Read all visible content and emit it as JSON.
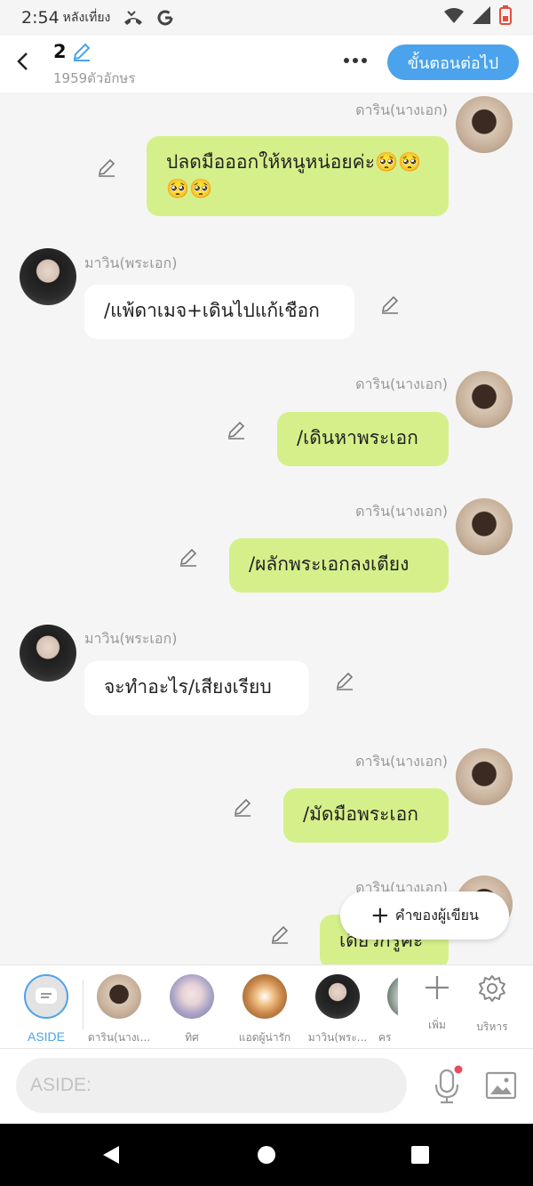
{
  "status": {
    "time": "2:54",
    "ampm": "หลังเที่ยง"
  },
  "header": {
    "chapter_number": "2",
    "char_count": "1959ตัวอักษร",
    "next_button": "ขั้นตอนต่อไป"
  },
  "messages": [
    {
      "side": "right",
      "name": "ดาริน(นางเอก)",
      "text": "ปลดมือออกให้หนูหน่อยค่ะ🥺🥺🥺🥺"
    },
    {
      "side": "left",
      "name": "มาวิน(พระเอก)",
      "text": "/แพ้ดาเมจ+เดินไปแก้เชือก"
    },
    {
      "side": "right",
      "name": "ดาริน(นางเอก)",
      "text": "/เดินหาพระเอก"
    },
    {
      "side": "right",
      "name": "ดาริน(นางเอก)",
      "text": "/ผลักพระเอกลงเตียง"
    },
    {
      "side": "left",
      "name": "มาวิน(พระเอก)",
      "text": "จะทำอะไร/เสียงเรียบ"
    },
    {
      "side": "right",
      "name": "ดาริน(นางเอก)",
      "text": "/มัดมือพระเอก"
    },
    {
      "side": "right",
      "name": "ดาริน(นางเอก)",
      "text": "เดียวกรูคะ"
    }
  ],
  "writer_button": "คำของผู้เขียน",
  "characters": [
    {
      "label": "ASIDE"
    },
    {
      "label": "ดาริน(นางเ..."
    },
    {
      "label": "ทิศ"
    },
    {
      "label": "แอดผู้น่ารัก"
    },
    {
      "label": "มาวิน(พระ..."
    },
    {
      "label": "คร"
    }
  ],
  "tools": {
    "add_label": "เพิ่ม",
    "manage_label": "บริหาร"
  },
  "input": {
    "placeholder": "ASIDE:"
  },
  "colors": {
    "accent": "#4aa3ec",
    "bubble_green": "#d5f08a"
  }
}
